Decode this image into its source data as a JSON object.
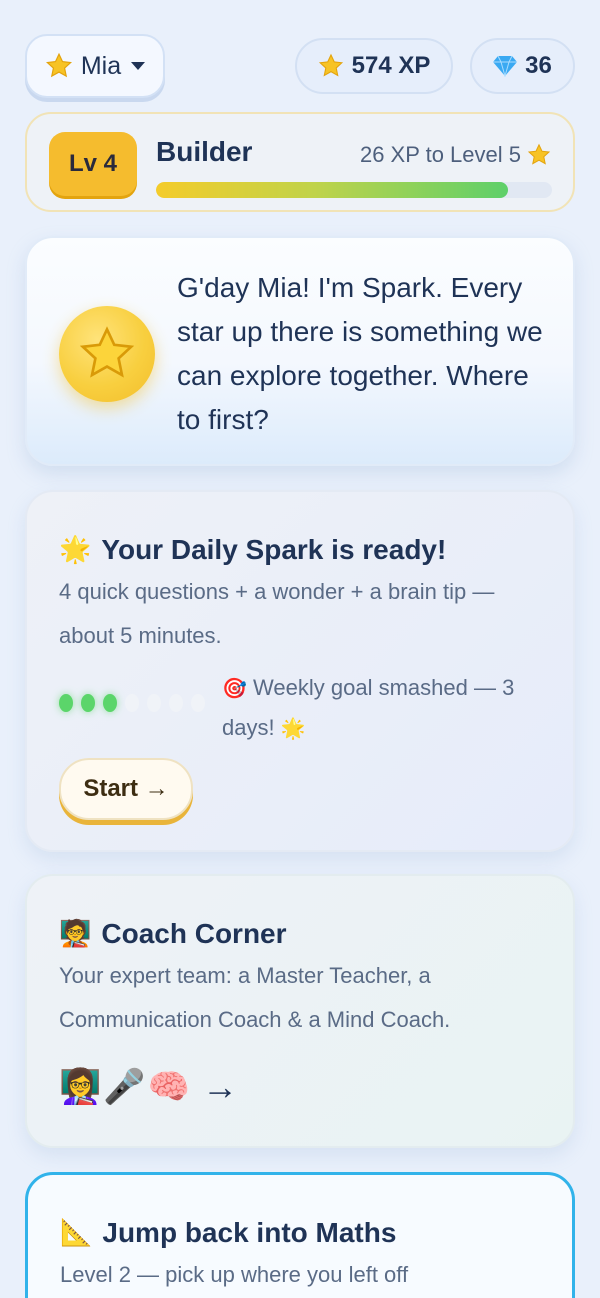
{
  "topbar": {
    "profile": {
      "icon": "star-icon",
      "name": "Mia"
    },
    "xp": {
      "icon": "star-icon",
      "label": "574 XP"
    },
    "gems": {
      "icon": "gem-icon",
      "label": "36"
    }
  },
  "level": {
    "badge": "Lv 4",
    "title": "Builder",
    "next": "26 XP to Level 5",
    "progress_fraction": 0.89
  },
  "spark": {
    "message": "G'day Mia! I'm Spark. Every star up there is something we can explore together. Where to first?"
  },
  "daily": {
    "icon": "🌟",
    "title": "Your Daily Spark is ready!",
    "desc": "4 quick questions + a wonder + a brain tip — about 5 minutes.",
    "streak": {
      "filled": 3,
      "total": 7
    },
    "goal_icon": "🎯",
    "goal": "Weekly goal smashed — 3 days!",
    "goal_end_icon": "🌟",
    "button": "Start →"
  },
  "coach": {
    "icon": "🧑‍🏫",
    "title": "Coach Corner",
    "desc": "Your expert team: a Master Teacher, a Communication Coach & a Mind Coach.",
    "emojis": [
      "👩‍🏫",
      "🎤",
      "🧠"
    ],
    "arrow": "→"
  },
  "maths": {
    "icon": "📐",
    "title": "Jump back into Maths",
    "desc": "Level 2 — pick up where you left off"
  },
  "colors": {
    "background": "#e9f0fb",
    "text": "#1f3356",
    "accent_gold": "#f5bc2e",
    "accent_green": "#5bd56a",
    "accent_blue": "#31b3ea"
  }
}
